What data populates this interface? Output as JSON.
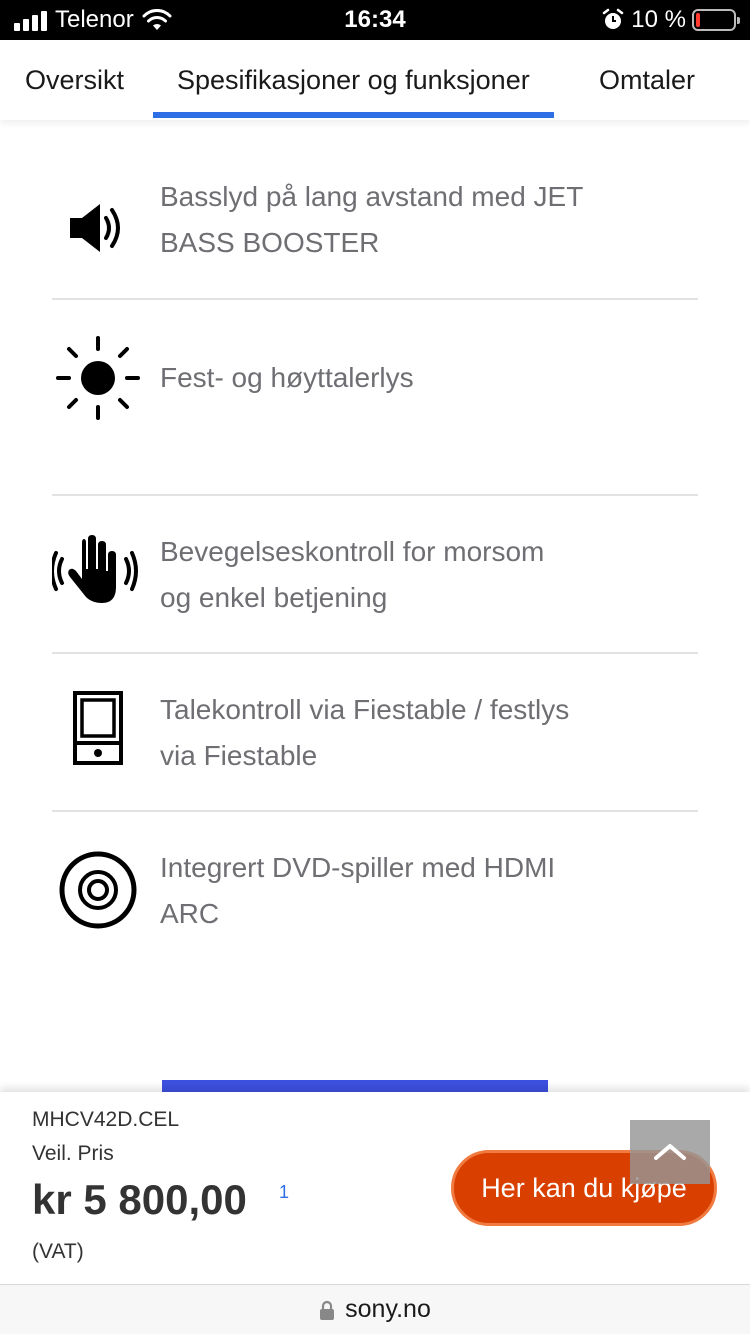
{
  "status_bar": {
    "carrier": "Telenor",
    "time": "16:34",
    "battery_percent": "10 %",
    "battery_level": 0.1
  },
  "tabs": [
    {
      "label": "Oversikt",
      "active": false
    },
    {
      "label": "Spesifikasjoner og funksjoner",
      "active": true
    },
    {
      "label": "Omtaler",
      "active": false
    }
  ],
  "features": [
    {
      "icon": "speaker-icon",
      "line1": "Basslyd på lang avstand med JET",
      "line2": "BASS BOOSTER"
    },
    {
      "icon": "sun-icon",
      "line1": "Fest- og høyttalerlys",
      "line2": ""
    },
    {
      "icon": "hand-wave-icon",
      "line1": "Bevegelseskontroll for morsom",
      "line2": "og enkel betjening"
    },
    {
      "icon": "phone-icon",
      "line1": "Talekontroll via Fiestable / festlys",
      "line2": "via Fiestable"
    },
    {
      "icon": "disc-icon",
      "line1": "Integrert DVD-spiller med HDMI",
      "line2": "ARC"
    }
  ],
  "purchase": {
    "model": "MHCV42D.CEL",
    "price_label": "Veil. Pris",
    "price": "kr 5 800,00",
    "footnote": "1",
    "vat": "(VAT)",
    "buy_label": "Her kan du kjøpe"
  },
  "browser": {
    "domain": "sony.no"
  },
  "colors": {
    "accent_blue": "#2e6fe6",
    "buy_button": "#d94000",
    "feature_text": "#6e6e73"
  }
}
